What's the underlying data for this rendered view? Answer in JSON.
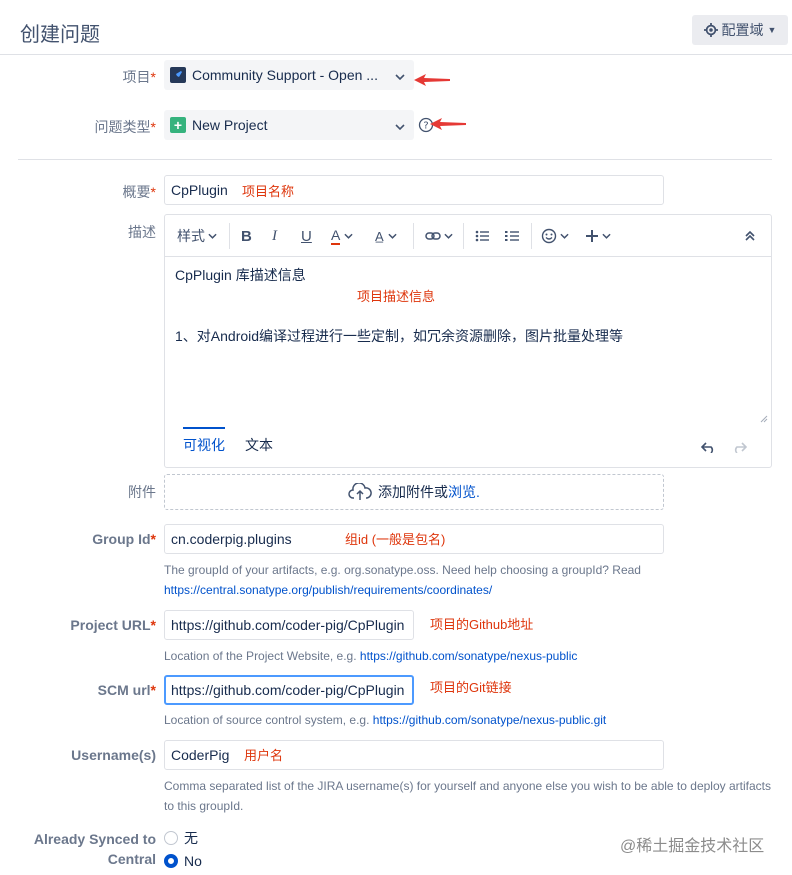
{
  "header": {
    "title": "创建问题",
    "config_label": "配置域"
  },
  "project": {
    "label": "项目",
    "value": "Community Support - Open ..."
  },
  "issue_type": {
    "label": "问题类型",
    "value": "New Project"
  },
  "summary": {
    "label": "概要",
    "value": "CpPlugin",
    "note": "项目名称"
  },
  "description": {
    "label": "描述",
    "toolbar": {
      "style_label": "样式"
    },
    "line1": "CpPlugin 库描述信息",
    "note": "项目描述信息",
    "line2": "1、对Android编译过程进行一些定制，如冗余资源删除，图片批量处理等",
    "tab_visual": "可视化",
    "tab_text": "文本"
  },
  "attachment": {
    "label": "附件",
    "text": "添加附件或",
    "browse": "浏览."
  },
  "group_id": {
    "label": "Group Id",
    "value": "cn.coderpig.plugins",
    "note": "组id (一般是包名)",
    "help": "The groupId of your artifacts, e.g. org.sonatype.oss. Need help choosing a groupId? Read",
    "help_link": "https://central.sonatype.org/publish/requirements/coordinates/"
  },
  "project_url": {
    "label": "Project URL",
    "value": "https://github.com/coder-pig/CpPlugin",
    "note": "项目的Github地址",
    "help": "Location of the Project Website, e.g.",
    "help_link": "https://github.com/sonatype/nexus-public"
  },
  "scm_url": {
    "label": "SCM url",
    "value": "https://github.com/coder-pig/CpPlugin",
    "note": "项目的Git链接",
    "help": "Location of source control system, e.g.",
    "help_link": "https://github.com/sonatype/nexus-public.git"
  },
  "username": {
    "label": "Username(s)",
    "value": "CoderPig",
    "note": "用户名",
    "help1": "Comma separated list of the JIRA username(s) for yourself and anyone else you wish to be able to deploy artifacts",
    "help2": "to this groupId."
  },
  "synced": {
    "label1": "Already Synced to",
    "label2": "Central",
    "option_none": "无",
    "option_no": "No",
    "selected": "No"
  },
  "watermark": "@稀土掘金技术社区",
  "required_mark": "*",
  "colors": {
    "accent": "#0052cc",
    "required": "#de350b",
    "annotation": "#de350b"
  }
}
